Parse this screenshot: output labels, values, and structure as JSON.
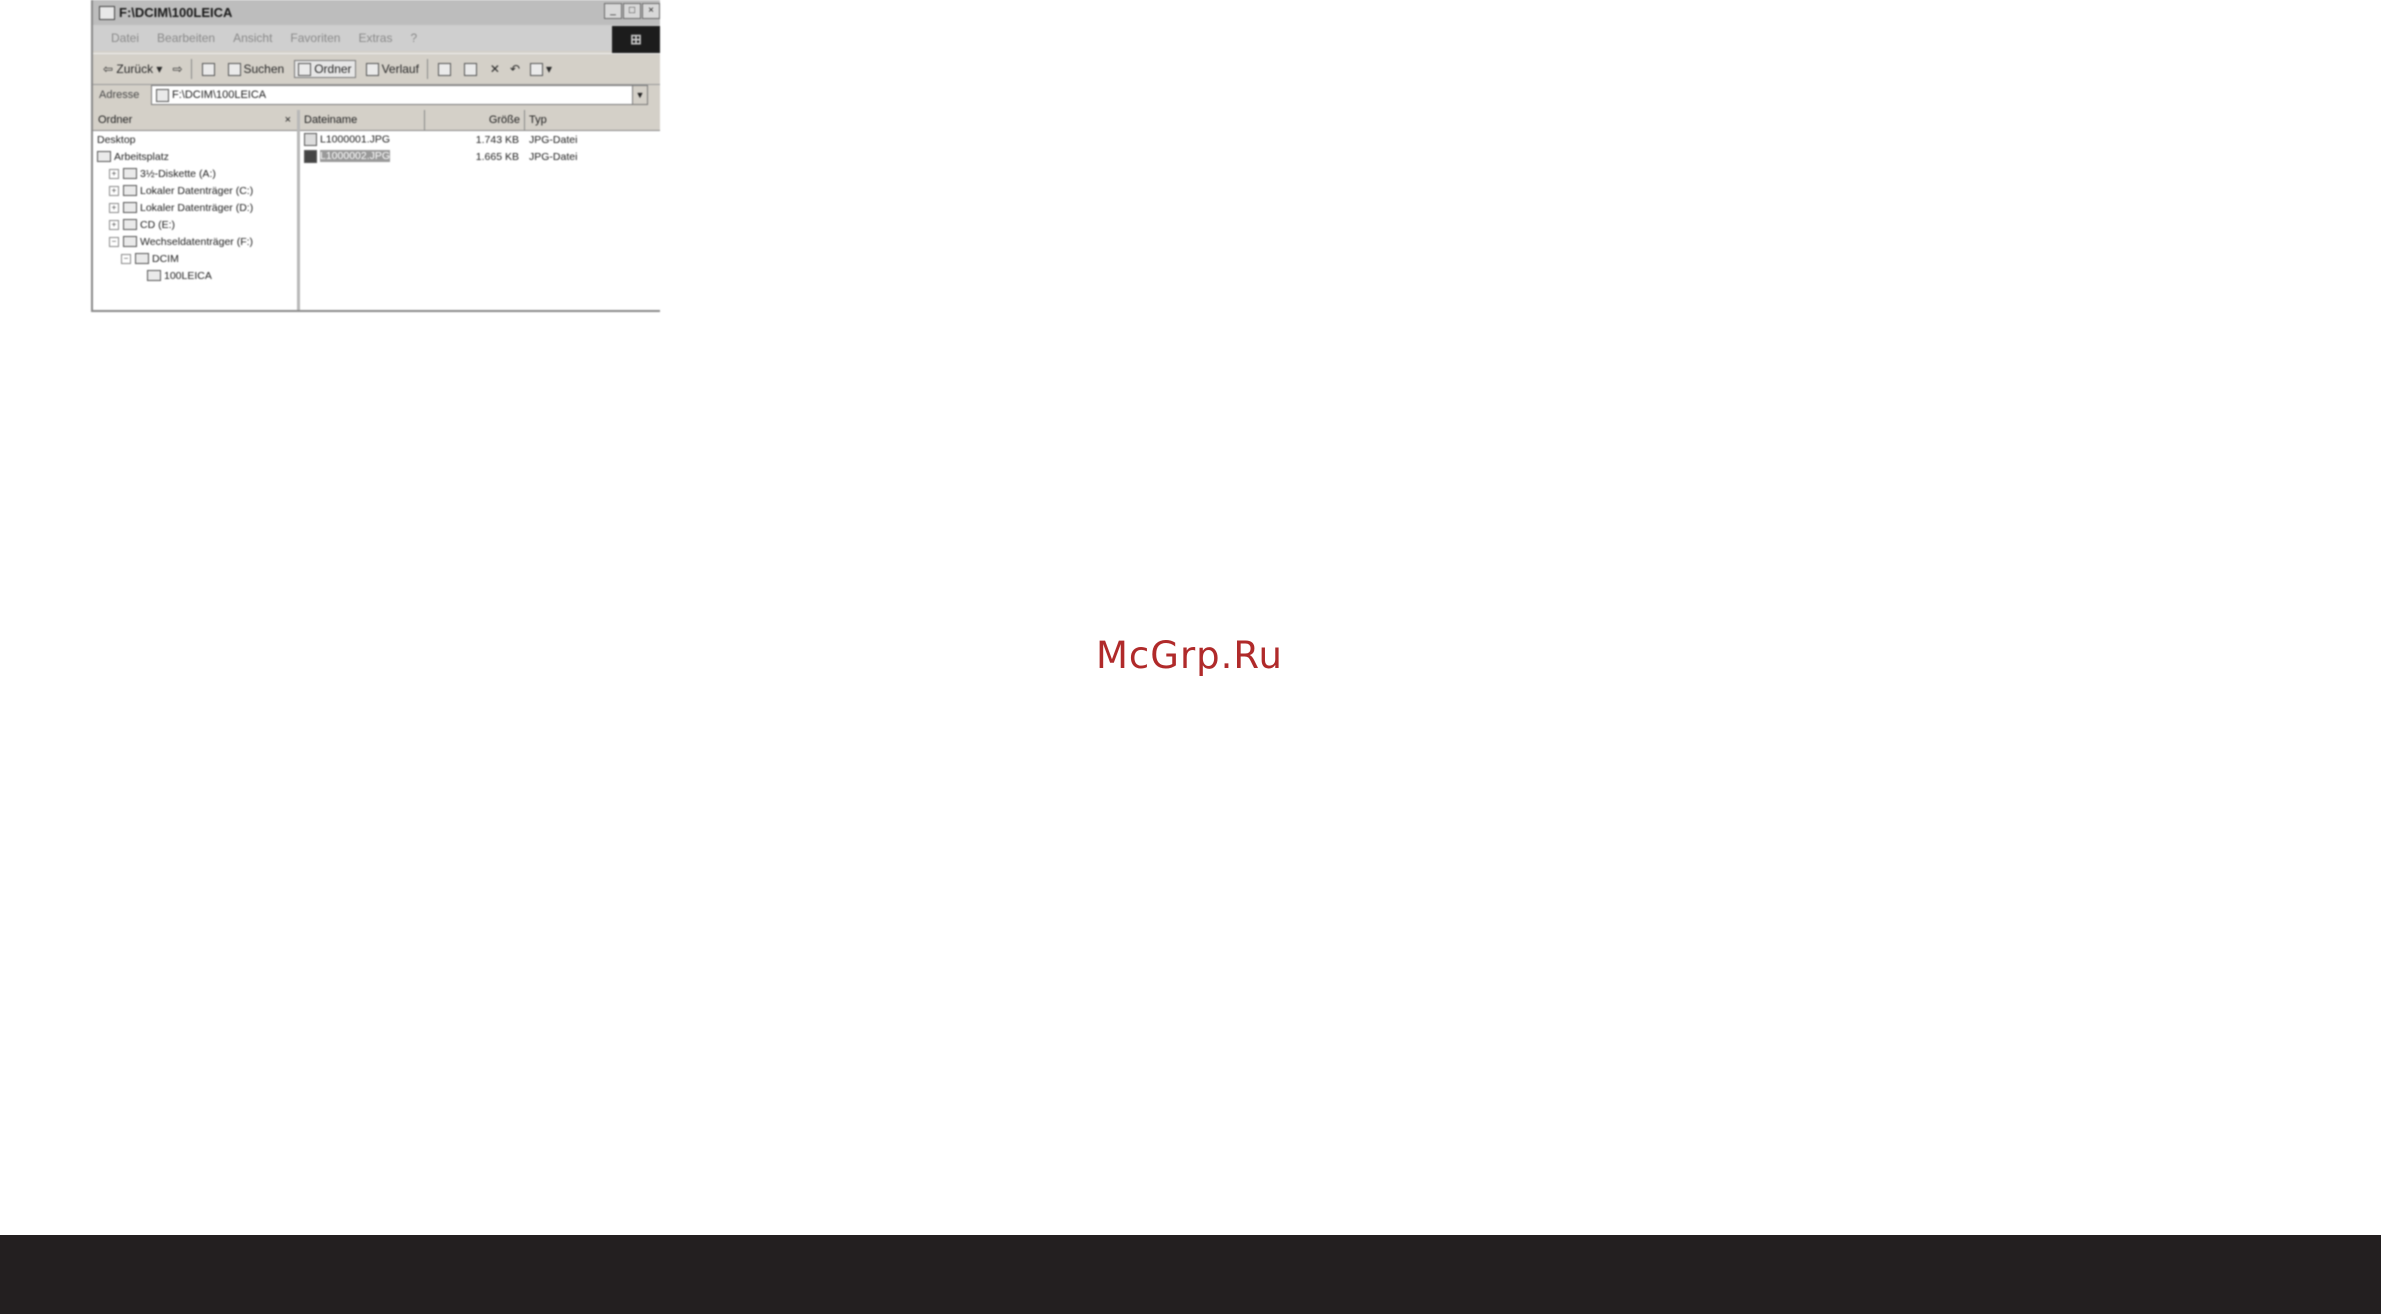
{
  "window": {
    "title": "F:\\DCIM\\100LEICA",
    "buttons": [
      "_",
      "□",
      "×"
    ]
  },
  "menubar": [
    "Datei",
    "Bearbeiten",
    "Ansicht",
    "Favoriten",
    "Extras",
    "?"
  ],
  "toolbar": {
    "back": "Zurück",
    "search": "Suchen",
    "folders": "Ordner",
    "history": "Verlauf"
  },
  "address": {
    "label": "Adresse",
    "value": "F:\\DCIM\\100LEICA"
  },
  "folders_pane": {
    "header": "Ordner",
    "close": "×",
    "items": [
      {
        "label": "Desktop",
        "level": 0,
        "expander": ""
      },
      {
        "label": "Arbeitsplatz",
        "level": 0,
        "expander": ""
      },
      {
        "label": "3½-Diskette (A:)",
        "level": 1,
        "expander": "+"
      },
      {
        "label": "Lokaler Datenträger (C:)",
        "level": 1,
        "expander": "+"
      },
      {
        "label": "Lokaler Datenträger (D:)",
        "level": 1,
        "expander": "+"
      },
      {
        "label": "CD (E:)",
        "level": 1,
        "expander": "+"
      },
      {
        "label": "Wechseldatenträger (F:)",
        "level": 1,
        "expander": "−"
      },
      {
        "label": "DCIM",
        "level": 2,
        "expander": "−"
      },
      {
        "label": "100LEICA",
        "level": 3,
        "expander": ""
      }
    ]
  },
  "file_list": {
    "columns": [
      "Dateiname",
      "Größe",
      "Typ"
    ],
    "rows": [
      {
        "name": "L1000001.JPG",
        "size": "1.743 KB",
        "type": "JPG-Datei",
        "selected": false
      },
      {
        "name": "L1000002.JPG",
        "size": "1.665 KB",
        "type": "JPG-Datei",
        "selected": true
      }
    ]
  },
  "watermark": "McGrp.Ru"
}
